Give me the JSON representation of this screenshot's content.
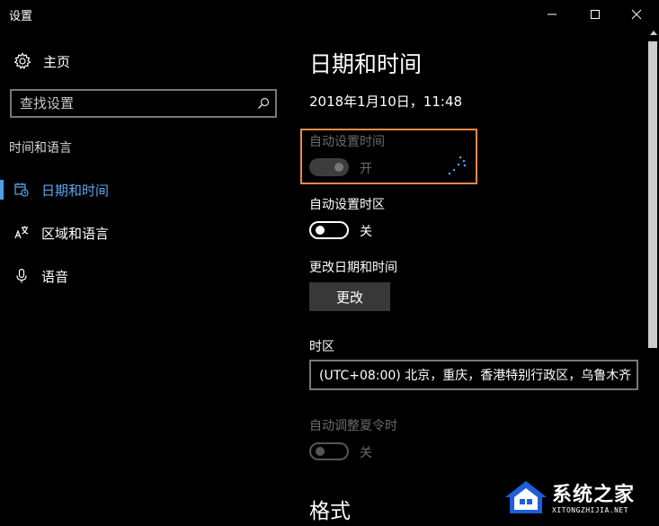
{
  "window": {
    "title": "设置"
  },
  "sidebar": {
    "home_label": "主页",
    "search_placeholder": "查找设置",
    "section_label": "时间和语言",
    "items": [
      {
        "label": "日期和时间",
        "icon": "calendar-clock-icon",
        "active": true
      },
      {
        "label": "区域和语言",
        "icon": "language-icon",
        "active": false
      },
      {
        "label": "语音",
        "icon": "microphone-icon",
        "active": false
      }
    ]
  },
  "main": {
    "title": "日期和时间",
    "current_datetime": "2018年1月10日，11:48",
    "auto_time": {
      "label": "自动设置时间",
      "state": "开",
      "enabled": false
    },
    "auto_timezone": {
      "label": "自动设置时区",
      "state": "关"
    },
    "change_datetime": {
      "label": "更改日期和时间",
      "button": "更改"
    },
    "timezone": {
      "label": "时区",
      "value": "(UTC+08:00) 北京，重庆，香港特别行政区，乌鲁木齐"
    },
    "dst": {
      "label": "自动调整夏令时",
      "state": "关",
      "enabled": false
    },
    "format_heading": "格式"
  },
  "watermark": {
    "main": "系统之家",
    "sub": "XITONGZHIJIA.NET"
  },
  "colors": {
    "accent": "#5aa7ec",
    "highlight": "#ea8a48",
    "background": "#000000"
  }
}
